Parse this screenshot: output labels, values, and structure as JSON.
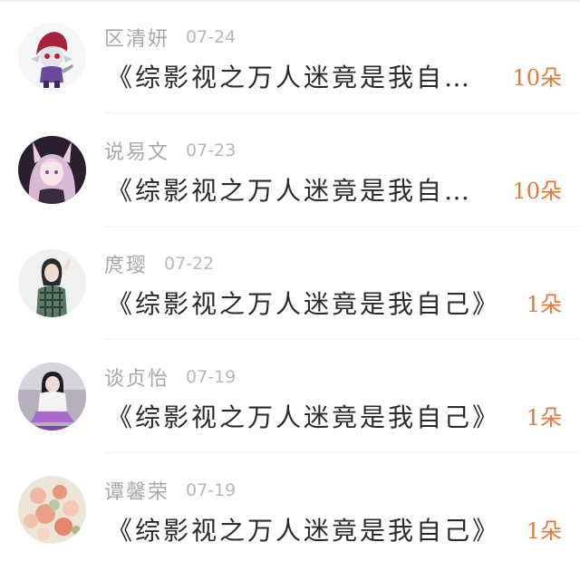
{
  "colors": {
    "accent": "#e07a3a",
    "sender_text": "#a8a8a8",
    "date_text": "#b8b8b8",
    "title_text": "#2a2a2a"
  },
  "gifts": [
    {
      "avatar": "avatar-hooded-figure",
      "sender": "区清妍",
      "date": "07-24",
      "title": "《综影视之万人迷竟是我自…",
      "count": "10朵"
    },
    {
      "avatar": "avatar-fox-ear-girl",
      "sender": "说易文",
      "date": "07-23",
      "title": "《综影视之万人迷竟是我自…",
      "count": "10朵"
    },
    {
      "avatar": "avatar-plaid-shirt-girl",
      "sender": "庹璎",
      "date": "07-22",
      "title": "《综影视之万人迷竟是我自己》",
      "count": "1朵"
    },
    {
      "avatar": "avatar-seated-girl",
      "sender": "谈贞怡",
      "date": "07-19",
      "title": "《综影视之万人迷竟是我自己》",
      "count": "1朵"
    },
    {
      "avatar": "avatar-flowers",
      "sender": "谭馨荣",
      "date": "07-19",
      "title": "《综影视之万人迷竟是我自己》",
      "count": "1朵"
    }
  ]
}
